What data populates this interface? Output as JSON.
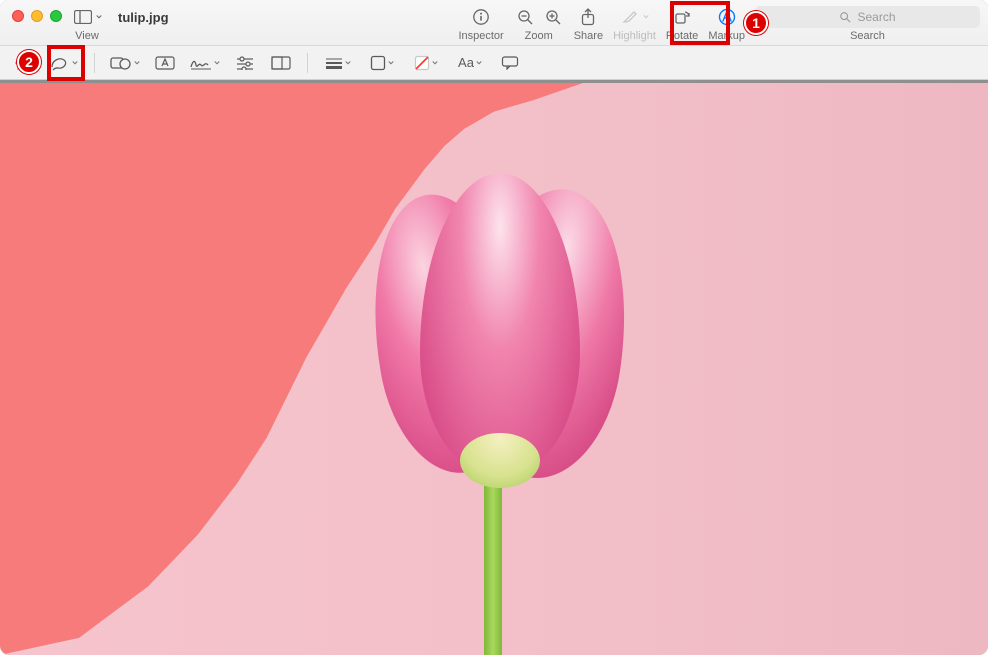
{
  "window": {
    "filename": "tulip.jpg"
  },
  "toolbar": {
    "view": "View",
    "inspector": "Inspector",
    "zoom": "Zoom",
    "share": "Share",
    "highlight": "Highlight",
    "rotate": "Rotate",
    "markup": "Markup",
    "search_label": "Search",
    "search_placeholder": "Search"
  },
  "annotations": {
    "callout1": "1",
    "callout2": "2"
  },
  "colors": {
    "accent": "#0a7aff",
    "callout": "#dd0000"
  }
}
